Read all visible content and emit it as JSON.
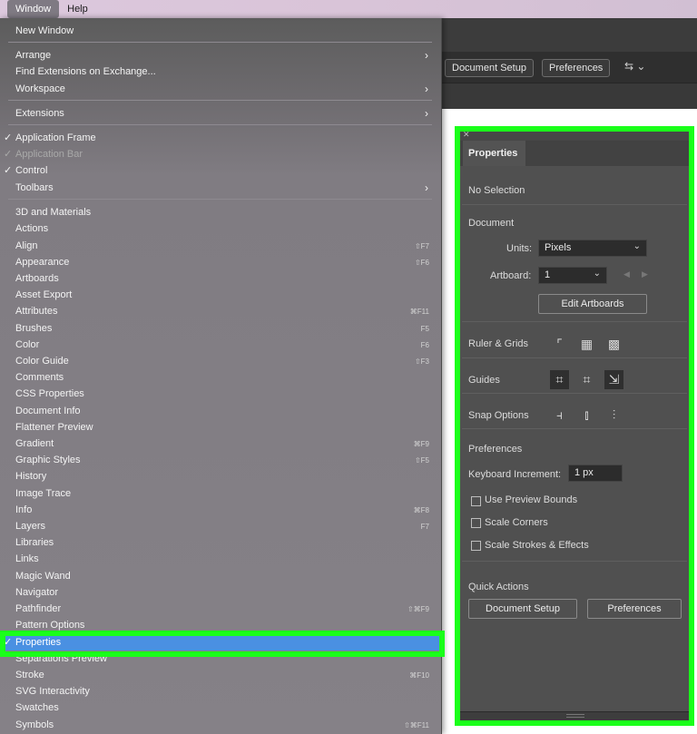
{
  "menubar": {
    "items": [
      "Window",
      "Help"
    ]
  },
  "control_bar": {
    "doc_setup": "Document Setup",
    "preferences": "Preferences"
  },
  "panel": {
    "tab": "Properties",
    "no_selection": "No Selection",
    "document_heading": "Document",
    "units_label": "Units:",
    "units_value": "Pixels",
    "artboard_label": "Artboard:",
    "artboard_value": "1",
    "edit_artboards": "Edit Artboards",
    "ruler_grids": "Ruler & Grids",
    "guides": "Guides",
    "snap_options": "Snap Options",
    "preferences_heading": "Preferences",
    "keyboard_increment_label": "Keyboard Increment:",
    "keyboard_increment_value": "1 px",
    "use_preview_bounds": "Use Preview Bounds",
    "scale_corners": "Scale Corners",
    "scale_strokes": "Scale Strokes & Effects",
    "quick_actions": "Quick Actions",
    "qa_document_setup": "Document Setup",
    "qa_preferences": "Preferences"
  },
  "menu": {
    "items": [
      {
        "label": "New Window"
      },
      {
        "label": "Arrange",
        "submenu": true
      },
      {
        "label": "Find Extensions on Exchange..."
      },
      {
        "label": "Workspace",
        "submenu": true
      },
      {
        "label": "Extensions",
        "submenu": true
      },
      {
        "label": "Application Frame",
        "checked": true
      },
      {
        "label": "Application Bar",
        "checked": true,
        "disabled": true
      },
      {
        "label": "Control",
        "checked": true
      },
      {
        "label": "Toolbars",
        "submenu": true
      },
      {
        "label": "3D and Materials"
      },
      {
        "label": "Actions"
      },
      {
        "label": "Align",
        "shortcut": "⇧F7"
      },
      {
        "label": "Appearance",
        "shortcut": "⇧F6"
      },
      {
        "label": "Artboards"
      },
      {
        "label": "Asset Export"
      },
      {
        "label": "Attributes",
        "shortcut": "⌘F11"
      },
      {
        "label": "Brushes",
        "shortcut": "F5"
      },
      {
        "label": "Color",
        "shortcut": "F6"
      },
      {
        "label": "Color Guide",
        "shortcut": "⇧F3"
      },
      {
        "label": "Comments"
      },
      {
        "label": "CSS Properties"
      },
      {
        "label": "Document Info"
      },
      {
        "label": "Flattener Preview"
      },
      {
        "label": "Gradient",
        "shortcut": "⌘F9"
      },
      {
        "label": "Graphic Styles",
        "shortcut": "⇧F5"
      },
      {
        "label": "History"
      },
      {
        "label": "Image Trace"
      },
      {
        "label": "Info",
        "shortcut": "⌘F8"
      },
      {
        "label": "Layers",
        "shortcut": "F7"
      },
      {
        "label": "Libraries"
      },
      {
        "label": "Links"
      },
      {
        "label": "Magic Wand"
      },
      {
        "label": "Navigator"
      },
      {
        "label": "Pathfinder",
        "shortcut": "⇧⌘F9"
      },
      {
        "label": "Pattern Options"
      },
      {
        "label": "Properties",
        "checked": true,
        "highlighted": true
      },
      {
        "label": "Separations Preview"
      },
      {
        "label": "Stroke",
        "shortcut": "⌘F10"
      },
      {
        "label": "SVG Interactivity"
      },
      {
        "label": "Swatches"
      },
      {
        "label": "Symbols",
        "shortcut": "⇧⌘F11"
      }
    ]
  },
  "colors": {
    "highlight": "#4a90e2",
    "annotation": "#1aff1a"
  },
  "icons": {
    "check": "checkmark-icon",
    "submenu": "chevron-right-icon",
    "dropdown": "chevron-down-icon"
  }
}
